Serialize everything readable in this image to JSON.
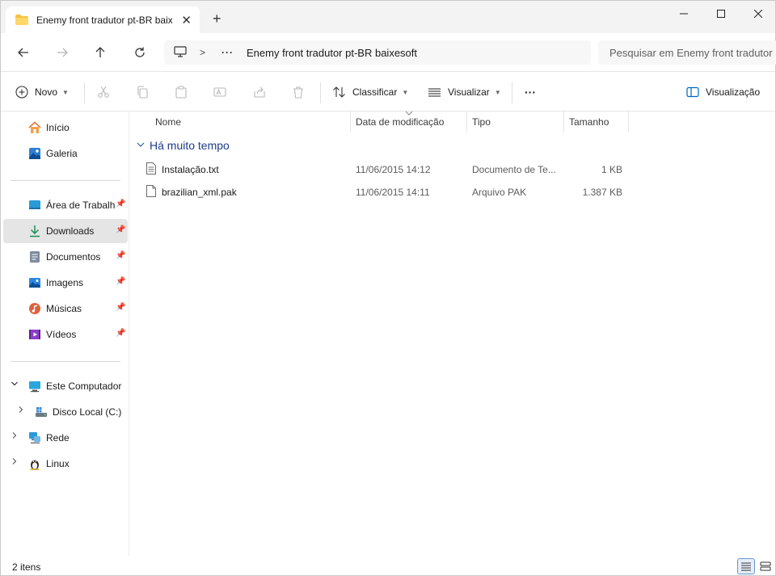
{
  "window": {
    "tab_title": "Enemy front tradutor pt-BR baixesoft",
    "tab_close_glyph": "✕",
    "new_tab_glyph": "+"
  },
  "address": {
    "separator": ">",
    "more": "···",
    "current_folder": "Enemy front tradutor pt-BR baixesoft"
  },
  "search": {
    "placeholder": "Pesquisar em Enemy front tradutor pt-BR baixesoft"
  },
  "commandbar": {
    "new_label": "Novo",
    "sort_label": "Classificar",
    "view_label": "Visualizar",
    "more_label": "···",
    "preview_label": "Visualização"
  },
  "sidebar": {
    "items": [
      {
        "label": "Início",
        "icon": "home-icon"
      },
      {
        "label": "Galeria",
        "icon": "gallery-icon"
      },
      {
        "label": "Área de Trabalho",
        "icon": "desktop-icon",
        "pinned": true
      },
      {
        "label": "Downloads",
        "icon": "download-icon",
        "pinned": true,
        "selected": true
      },
      {
        "label": "Documentos",
        "icon": "documents-icon",
        "pinned": true
      },
      {
        "label": "Imagens",
        "icon": "pictures-icon",
        "pinned": true
      },
      {
        "label": "Músicas",
        "icon": "music-icon",
        "pinned": true
      },
      {
        "label": "Vídeos",
        "icon": "videos-icon",
        "pinned": true
      },
      {
        "label": "Este Computador",
        "icon": "computer-icon",
        "expanded": true
      },
      {
        "label": "Disco Local (C:)",
        "icon": "drive-icon"
      },
      {
        "label": "Rede",
        "icon": "network-icon"
      },
      {
        "label": "Linux",
        "icon": "linux-icon"
      }
    ]
  },
  "columns": {
    "name": "Nome",
    "date": "Data de modificação",
    "type": "Tipo",
    "size": "Tamanho"
  },
  "group": {
    "label": "Há muito tempo"
  },
  "files": [
    {
      "name": "Instalação.txt",
      "date": "11/06/2015 14:12",
      "type": "Documento de Te...",
      "size": "1 KB",
      "icon": "text-file-icon"
    },
    {
      "name": "brazilian_xml.pak",
      "date": "11/06/2015 14:11",
      "type": "Arquivo PAK",
      "size": "1.387 KB",
      "icon": "file-icon"
    }
  ],
  "status": {
    "item_count": "2 itens"
  },
  "colors": {
    "accent": "#0067c0",
    "group_header": "#1e3c8c",
    "folder_yellow": "#f5c342",
    "selected_bg": "#e5e5e5"
  }
}
